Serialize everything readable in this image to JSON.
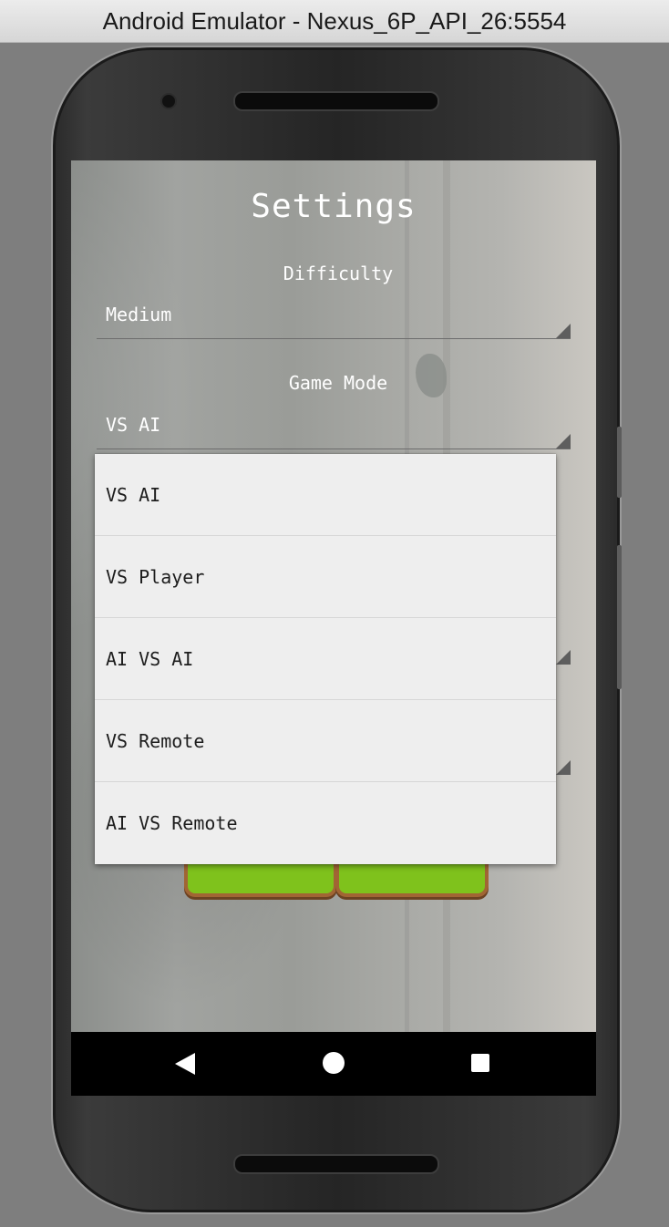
{
  "window": {
    "title": "Android Emulator - Nexus_6P_API_26:5554"
  },
  "settings": {
    "title": "Settings",
    "difficulty": {
      "label": "Difficulty",
      "value": "Medium"
    },
    "game_mode": {
      "label": "Game Mode",
      "value": "VS AI"
    }
  },
  "game_mode_dropdown": {
    "options": [
      "VS AI",
      "VS Player",
      "AI VS AI",
      "VS Remote",
      "AI VS Remote"
    ]
  },
  "colors": {
    "button_green": "#7fc21c",
    "button_border": "#a16534",
    "dropdown_bg": "#eeeeee"
  },
  "icons": {
    "nav_back": "triangle-back-icon",
    "nav_home": "circle-home-icon",
    "nav_recents": "square-recents-icon"
  }
}
